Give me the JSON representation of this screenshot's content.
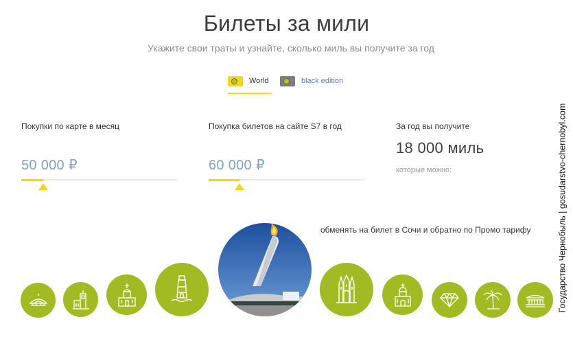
{
  "header": {
    "title": "Билеты за мили",
    "subtitle": "Укажите свои траты и узнайте, сколько миль вы получите за год"
  },
  "card_tabs": [
    {
      "label": "World",
      "chip_color": "#f7d619",
      "selected": true
    },
    {
      "label": "black edition",
      "chip_color": "#7d7d7d",
      "selected": false
    }
  ],
  "calculator": {
    "card_spend": {
      "label": "Покупки по карте в месяц",
      "value": "50 000 ₽",
      "level": 0.14
    },
    "s7_spend": {
      "label": "Покупка билетов на сайте S7 в год",
      "value": "60 000 ₽",
      "level": 0.2
    }
  },
  "result": {
    "label": "За год вы получите",
    "value": "18 000 миль",
    "note": "которые можно:"
  },
  "exchange_text": "обменять на билет в Сочи и обратно по Промо тарифу",
  "destinations": [
    {
      "icon": "dome-icon"
    },
    {
      "icon": "tower-icon"
    },
    {
      "icon": "church-icon"
    },
    {
      "icon": "lighthouse-icon"
    },
    {
      "icon": "olympic-torch-photo"
    },
    {
      "icon": "cathedral-icon"
    },
    {
      "icon": "orthodox-church-icon"
    },
    {
      "icon": "diamond-icon"
    },
    {
      "icon": "palm-tree-icon"
    },
    {
      "icon": "theater-icon"
    }
  ],
  "watermark": "Государство Чернобыль | gosudarstvo-chernobyl.com",
  "colors": {
    "accent_yellow": "#f7d619",
    "circle_green": "#a2bb23",
    "value_blue": "#7fa2c2",
    "link_blue": "#5a7ea8"
  }
}
